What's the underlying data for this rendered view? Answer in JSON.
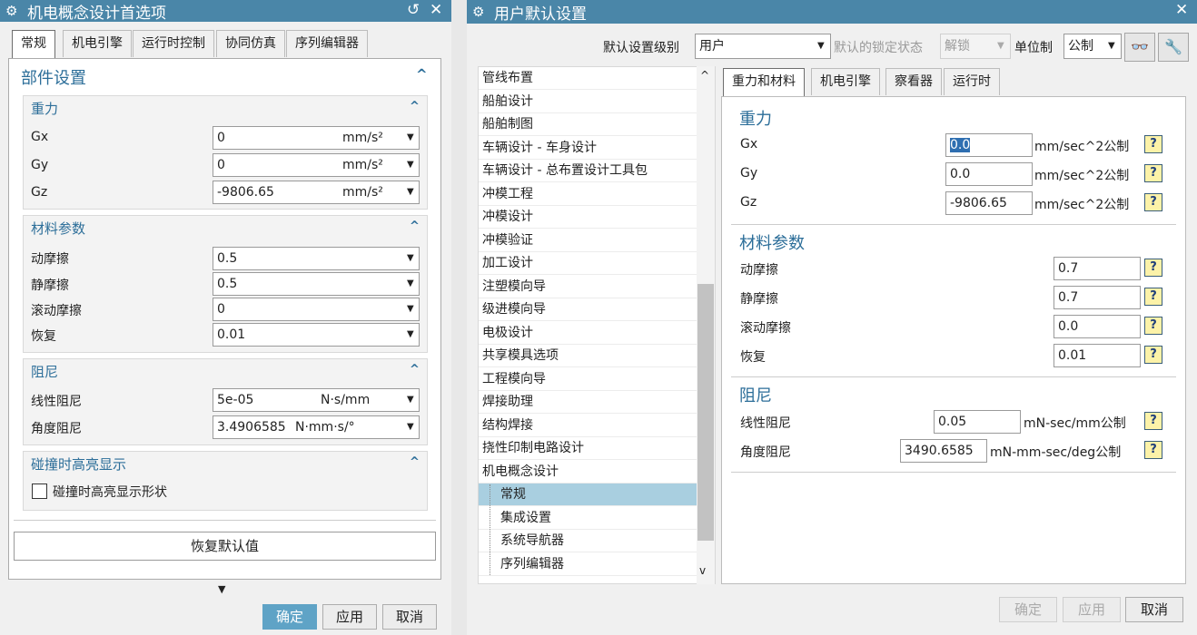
{
  "left": {
    "title": "机电概念设计首选项",
    "tabs": [
      "常规",
      "机电引擎",
      "运行时控制",
      "协同仿真",
      "序列编辑器"
    ],
    "component_settings": "部件设置",
    "gravity": {
      "header": "重力",
      "rows": [
        {
          "label": "Gx",
          "value": "0",
          "unit": "mm/s²"
        },
        {
          "label": "Gy",
          "value": "0",
          "unit": "mm/s²"
        },
        {
          "label": "Gz",
          "value": "-9806.65",
          "unit": "mm/s²"
        }
      ]
    },
    "material": {
      "header": "材料参数",
      "rows": [
        {
          "label": "动摩擦",
          "value": "0.5"
        },
        {
          "label": "静摩擦",
          "value": "0.5"
        },
        {
          "label": "滚动摩擦",
          "value": "0"
        },
        {
          "label": "恢复",
          "value": "0.01"
        }
      ]
    },
    "damping": {
      "header": "阻尼",
      "rows": [
        {
          "label": "线性阻尼",
          "value": "5e-05",
          "unit": "N·s/mm"
        },
        {
          "label": "角度阻尼",
          "value": "3.4906585",
          "unit": "N·mm·s/°"
        }
      ]
    },
    "collision": {
      "header": "碰撞时高亮显示",
      "checkbox_label": "碰撞时高亮显示形状",
      "checked": false
    },
    "restore_default": "恢复默认值",
    "buttons": {
      "ok": "确定",
      "apply": "应用",
      "cancel": "取消"
    }
  },
  "right": {
    "title": "用户默认设置",
    "toolbar": {
      "level_label": "默认设置级别",
      "level_value": "用户",
      "lock_label": "默认的锁定状态",
      "lock_value": "解锁",
      "unit_label": "单位制",
      "unit_value": "公制"
    },
    "tree": [
      {
        "label": "管线布置",
        "child": false
      },
      {
        "label": "船舶设计",
        "child": false
      },
      {
        "label": "船舶制图",
        "child": false
      },
      {
        "label": "车辆设计 - 车身设计",
        "child": false
      },
      {
        "label": "车辆设计 - 总布置设计工具包",
        "child": false
      },
      {
        "label": "冲模工程",
        "child": false
      },
      {
        "label": "冲模设计",
        "child": false
      },
      {
        "label": "冲模验证",
        "child": false
      },
      {
        "label": "加工设计",
        "child": false
      },
      {
        "label": "注塑模向导",
        "child": false
      },
      {
        "label": "级进模向导",
        "child": false
      },
      {
        "label": "电极设计",
        "child": false
      },
      {
        "label": "共享模具选项",
        "child": false
      },
      {
        "label": "工程模向导",
        "child": false
      },
      {
        "label": "焊接助理",
        "child": false
      },
      {
        "label": "结构焊接",
        "child": false
      },
      {
        "label": "挠性印制电路设计",
        "child": false
      },
      {
        "label": "机电概念设计",
        "child": false
      },
      {
        "label": "常规",
        "child": true,
        "selected": true
      },
      {
        "label": "集成设置",
        "child": true
      },
      {
        "label": "系统导航器",
        "child": true
      },
      {
        "label": "序列编辑器",
        "child": true
      }
    ],
    "tabs": [
      "重力和材料",
      "机电引擎",
      "察看器",
      "运行时"
    ],
    "gravity": {
      "header": "重力",
      "rows": [
        {
          "label": "Gx",
          "value": "0.0",
          "unit": "mm/sec^2公制"
        },
        {
          "label": "Gy",
          "value": "0.0",
          "unit": "mm/sec^2公制"
        },
        {
          "label": "Gz",
          "value": "-9806.65",
          "unit": "mm/sec^2公制"
        }
      ]
    },
    "material": {
      "header": "材料参数",
      "rows": [
        {
          "label": "动摩擦",
          "value": "0.7"
        },
        {
          "label": "静摩擦",
          "value": "0.7"
        },
        {
          "label": "滚动摩擦",
          "value": "0.0"
        },
        {
          "label": "恢复",
          "value": "0.01"
        }
      ]
    },
    "damping": {
      "header": "阻尼",
      "rows": [
        {
          "label": "线性阻尼",
          "value": "0.05",
          "unit": "mN-sec/mm公制"
        },
        {
          "label": "角度阻尼",
          "value": "3490.6585",
          "unit": "mN-mm-sec/deg公制"
        }
      ]
    },
    "buttons": {
      "ok": "确定",
      "apply": "应用",
      "cancel": "取消"
    }
  }
}
